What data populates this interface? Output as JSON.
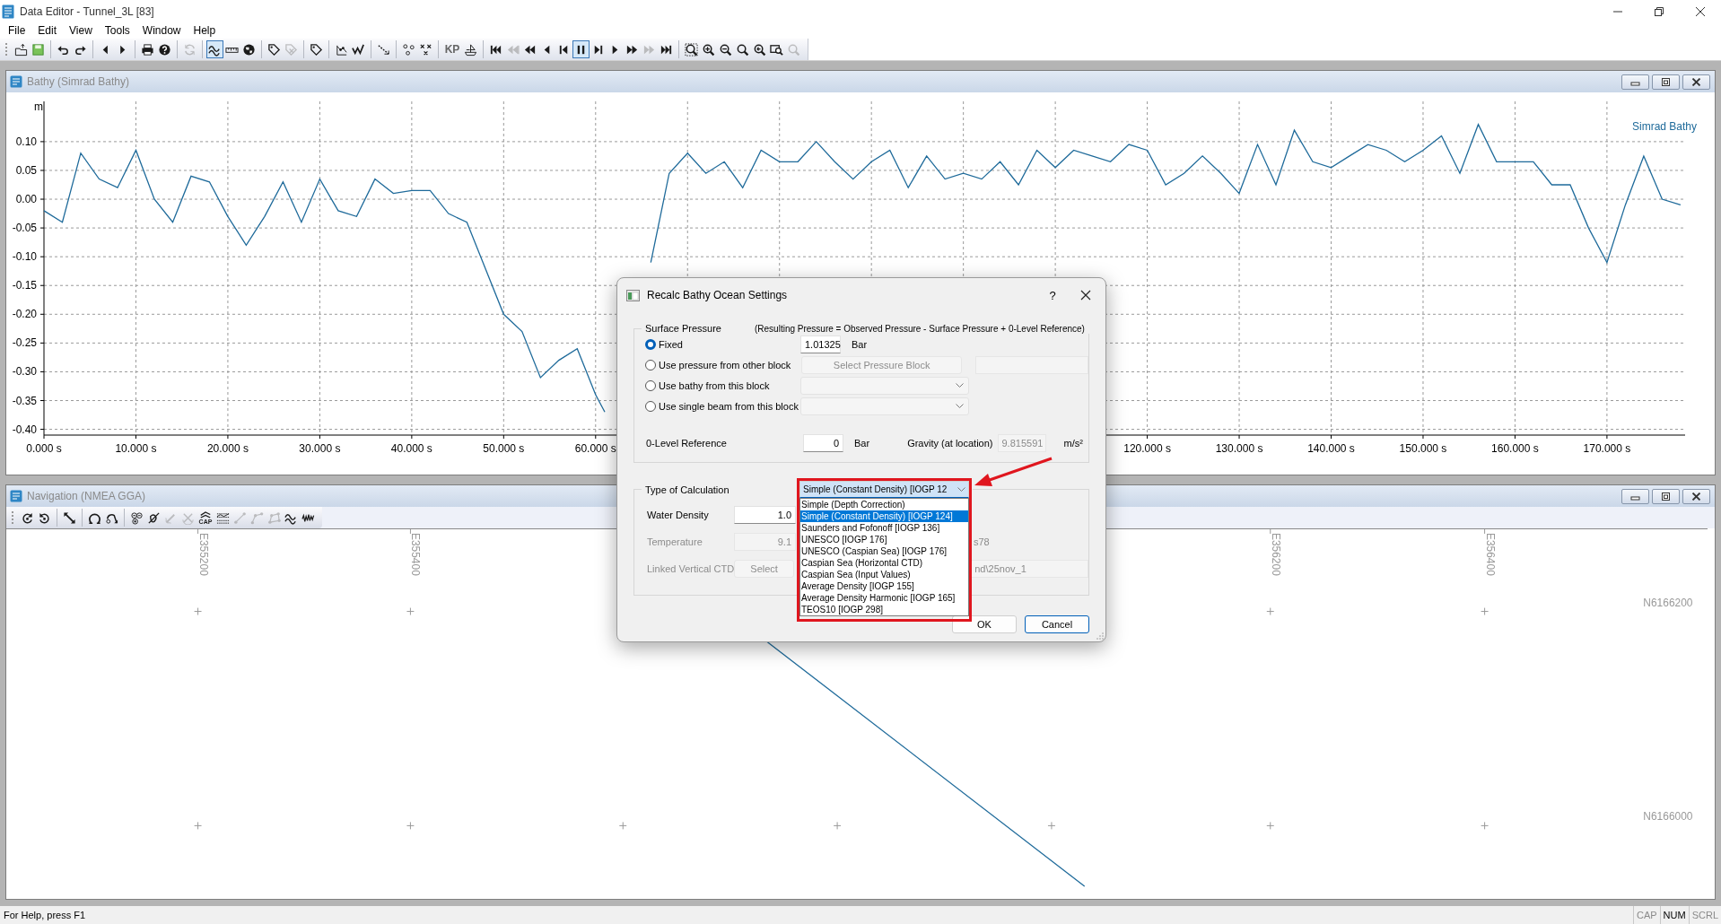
{
  "window": {
    "title": "Data Editor - Tunnel_3L [83]"
  },
  "menu": [
    "File",
    "Edit",
    "View",
    "Tools",
    "Window",
    "Help"
  ],
  "toolbar": [
    [
      {
        "kind": "folder",
        "selected": false,
        "disabled": false
      },
      {
        "kind": "floppy",
        "selected": false,
        "disabled": false
      }
    ],
    [
      {
        "kind": "undo",
        "selected": false,
        "disabled": false
      },
      {
        "kind": "redo",
        "selected": false,
        "disabled": false
      }
    ],
    [
      {
        "kind": "tri-left",
        "selected": false,
        "disabled": false
      },
      {
        "kind": "tri-right",
        "selected": false,
        "disabled": false
      }
    ],
    [
      {
        "kind": "printer",
        "selected": false,
        "disabled": false
      },
      {
        "kind": "help",
        "selected": false,
        "disabled": false
      }
    ],
    [
      {
        "kind": "refresh",
        "selected": false,
        "disabled": true
      }
    ],
    [
      {
        "kind": "wave",
        "selected": true,
        "disabled": false
      },
      {
        "kind": "ruler",
        "selected": false,
        "disabled": false
      },
      {
        "kind": "globe",
        "selected": false,
        "disabled": false
      }
    ],
    [
      {
        "kind": "tag",
        "selected": false,
        "disabled": false
      },
      {
        "kind": "tag-x",
        "selected": false,
        "disabled": true
      }
    ],
    [
      {
        "kind": "tag",
        "selected": false,
        "disabled": false
      }
    ],
    [
      {
        "kind": "graph",
        "selected": false,
        "disabled": false
      },
      {
        "kind": "zigzag",
        "selected": false,
        "disabled": false
      }
    ],
    [
      {
        "kind": "diagonal",
        "selected": false,
        "disabled": false
      }
    ],
    [
      {
        "kind": "dots",
        "selected": false,
        "disabled": false
      },
      {
        "kind": "dots-x",
        "selected": false,
        "disabled": false
      }
    ],
    [
      {
        "kind": "text",
        "label": "KP",
        "selected": false,
        "disabled": false
      },
      {
        "kind": "boat",
        "selected": false,
        "disabled": false
      }
    ],
    [
      {
        "kind": "first",
        "selected": false,
        "disabled": false
      },
      {
        "kind": "fastback",
        "selected": false,
        "disabled": true
      },
      {
        "kind": "rewind",
        "selected": false,
        "disabled": false
      },
      {
        "kind": "back",
        "selected": false,
        "disabled": false
      },
      {
        "kind": "prev",
        "selected": false,
        "disabled": false
      },
      {
        "kind": "pause",
        "selected": true,
        "disabled": false
      },
      {
        "kind": "next",
        "selected": false,
        "disabled": false
      },
      {
        "kind": "play",
        "selected": false,
        "disabled": false
      },
      {
        "kind": "fastfwd",
        "selected": false,
        "disabled": false
      },
      {
        "kind": "fastfwd",
        "selected": false,
        "disabled": true
      },
      {
        "kind": "last",
        "selected": false,
        "disabled": false
      }
    ],
    [
      {
        "kind": "zoom-box",
        "selected": false,
        "disabled": false
      },
      {
        "kind": "zoom-in",
        "selected": false,
        "disabled": false
      },
      {
        "kind": "zoom-out",
        "selected": false,
        "disabled": false
      },
      {
        "kind": "zoom",
        "selected": false,
        "disabled": false
      },
      {
        "kind": "zoom-back",
        "selected": false,
        "disabled": false
      },
      {
        "kind": "zoom-window",
        "selected": false,
        "disabled": false
      },
      {
        "kind": "zoom",
        "selected": false,
        "disabled": true
      }
    ]
  ],
  "bathy_window": {
    "title": "Bathy (Simrad Bathy)",
    "chart_data": {
      "type": "line",
      "ylabel": "m",
      "grid": true,
      "x": [
        0,
        2,
        4,
        6,
        8,
        10,
        12,
        14,
        16,
        18,
        20,
        22,
        24,
        26,
        28,
        30,
        32,
        34,
        36,
        38,
        40,
        42,
        44,
        46,
        48,
        50,
        52,
        54,
        56,
        58,
        60,
        61,
        63,
        66,
        68,
        70,
        72,
        74,
        76,
        78,
        80,
        82,
        84,
        86,
        88,
        90,
        92,
        94,
        96,
        98,
        100,
        102,
        104,
        106,
        108,
        110,
        112,
        114,
        116,
        118,
        120,
        122,
        124,
        126,
        128,
        130,
        132,
        134,
        136,
        138,
        140,
        142,
        144,
        146,
        148,
        150,
        152,
        154,
        156,
        158,
        160,
        162,
        164,
        166,
        168,
        170,
        172,
        174,
        176,
        178
      ],
      "series": [
        {
          "name": "Simrad Bathy",
          "color": "#1e6a9a",
          "values": [
            -0.02,
            -0.04,
            0.08,
            0.035,
            0.02,
            0.085,
            0,
            -0.04,
            0.04,
            0.03,
            -0.03,
            -0.08,
            -0.03,
            0.03,
            -0.04,
            0.035,
            -0.02,
            -0.03,
            0.035,
            0.01,
            0.015,
            0.015,
            -0.025,
            -0.04,
            -0.12,
            -0.2,
            -0.23,
            -0.31,
            -0.28,
            -0.26,
            -0.34,
            -0.37,
            null,
            -0.11,
            0.045,
            0.08,
            0.045,
            0.065,
            0.02,
            0.085,
            0.065,
            0.065,
            0.1,
            0.065,
            0.035,
            0.065,
            0.085,
            0.02,
            0.075,
            0.035,
            0.045,
            0.035,
            0.065,
            0.025,
            0.085,
            0.055,
            0.085,
            0.075,
            0.065,
            0.095,
            0.085,
            0.025,
            0.045,
            0.075,
            0.045,
            0.01,
            0.095,
            0.025,
            0.12,
            0.065,
            0.055,
            0.075,
            0.095,
            0.085,
            0.065,
            0.085,
            0.11,
            0.045,
            0.13,
            0.065,
            0.065,
            0.065,
            0.025,
            0.025,
            -0.05,
            -0.11,
            -0.01,
            0.075,
            0,
            -0.01
          ]
        }
      ],
      "xlim": [
        0,
        178.5
      ],
      "ylim": [
        -0.41,
        0.17
      ],
      "xticks": [
        {
          "value": 0,
          "label": "0.000 s"
        },
        {
          "value": 10,
          "label": "10.000 s"
        },
        {
          "value": 20,
          "label": "20.000 s"
        },
        {
          "value": 30,
          "label": "30.000 s"
        },
        {
          "value": 40,
          "label": "40.000 s"
        },
        {
          "value": 50,
          "label": "50.000 s"
        },
        {
          "value": 60,
          "label": "60.000 s"
        },
        {
          "value": 120,
          "label": "120.000 s"
        },
        {
          "value": 130,
          "label": "130.000 s"
        },
        {
          "value": 140,
          "label": "140.000 s"
        },
        {
          "value": 150,
          "label": "150.000 s"
        },
        {
          "value": 160,
          "label": "160.000 s"
        },
        {
          "value": 170,
          "label": "170.000 s"
        }
      ],
      "yticks": [
        {
          "value": 0.1,
          "label": "0.10"
        },
        {
          "value": 0.05,
          "label": "0.05"
        },
        {
          "value": 0,
          "label": "0.00"
        },
        {
          "value": -0.05,
          "label": "-0.05"
        },
        {
          "value": -0.1,
          "label": "-0.10"
        },
        {
          "value": -0.15,
          "label": "-0.15"
        },
        {
          "value": -0.2,
          "label": "-0.20"
        },
        {
          "value": -0.25,
          "label": "-0.25"
        },
        {
          "value": -0.3,
          "label": "-0.30"
        },
        {
          "value": -0.35,
          "label": "-0.35"
        },
        {
          "value": -0.4,
          "label": "-0.40"
        }
      ]
    }
  },
  "navigation_window": {
    "title": "Navigation (NMEA GGA)",
    "toolbar": [
      [
        {
          "kind": "rotate-cw",
          "disabled": false
        },
        {
          "kind": "rotate-ccw",
          "disabled": false
        }
      ],
      [
        {
          "kind": "diag-arrow",
          "disabled": false
        }
      ],
      [
        {
          "kind": "loop",
          "disabled": false
        },
        {
          "kind": "route",
          "disabled": false
        }
      ],
      [
        {
          "kind": "circles",
          "disabled": false
        },
        {
          "kind": "pen-cross",
          "disabled": false
        },
        {
          "kind": "sonar",
          "disabled": true
        },
        {
          "kind": "sonar-x",
          "disabled": true
        },
        {
          "kind": "cap",
          "label": "CAP",
          "disabled": false
        },
        {
          "kind": "hatch",
          "disabled": false
        },
        {
          "kind": "segment",
          "disabled": true
        },
        {
          "kind": "polyline",
          "disabled": true
        },
        {
          "kind": "polygon",
          "disabled": true
        },
        {
          "kind": "wave",
          "disabled": false
        },
        {
          "kind": "wave2",
          "disabled": false
        }
      ]
    ],
    "map": {
      "eastings": [
        "E355200",
        "E355400",
        "E356200",
        "E356400"
      ],
      "northings": [
        "N6166200",
        "N6166000"
      ]
    }
  },
  "dialog": {
    "title": "Recalc Bathy Ocean Settings",
    "help": "?",
    "surface_pressure": {
      "label": "Surface Pressure",
      "note": "(Resulting Pressure = Observed Pressure - Surface Pressure + 0-Level Reference)",
      "options": [
        {
          "label": "Fixed",
          "selected": true
        },
        {
          "label": "Use pressure from other block",
          "selected": false
        },
        {
          "label": "Use bathy from this block",
          "selected": false
        },
        {
          "label": "Use single beam from this block",
          "selected": false
        }
      ],
      "fixed": {
        "value": "1.01325",
        "unit": "Bar"
      },
      "pressure_block_button": {
        "label": "Select Pressure Block",
        "disabled": true
      },
      "zero_level": {
        "label": "0-Level Reference",
        "value": "0",
        "unit": "Bar"
      },
      "gravity": {
        "label": "Gravity (at location)",
        "value": "9.815591",
        "unit": "m/s²"
      }
    },
    "calculation": {
      "label": "Type of Calculation",
      "value": "Simple (Constant Density) [IOGP 12",
      "expanded": true,
      "options": [
        {
          "label": "Simple (Depth Correction)",
          "selected": false
        },
        {
          "label": "Simple (Constant Density) [IOGP 124]",
          "selected": true
        },
        {
          "label": "Saunders and Fofonoff [IOGP 136]",
          "selected": false
        },
        {
          "label": "UNESCO [IOGP 176]",
          "selected": false
        },
        {
          "label": "UNESCO (Caspian Sea) [IOGP 176]",
          "selected": false
        },
        {
          "label": "Caspian Sea (Horizontal CTD)",
          "selected": false
        },
        {
          "label": "Caspian Sea (Input Values)",
          "selected": false
        },
        {
          "label": "Average Density [IOGP 155]",
          "selected": false
        },
        {
          "label": "Average Density Harmonic [IOGP 165]",
          "selected": false
        },
        {
          "label": "TEOS10 [IOGP 298]",
          "selected": false
        }
      ],
      "highlight": {
        "color": "#e0161e"
      },
      "pointer_arrow": {
        "color": "#e0161e"
      }
    },
    "water_density": {
      "label": "Water Density",
      "value": "1.0",
      "disabled": false
    },
    "temperature": {
      "label": "Temperature",
      "value": "9.1",
      "tail": "s78",
      "disabled": true
    },
    "linked_ctd": {
      "label": "Linked Vertical CTD",
      "button": "Select",
      "path": "nd\\25nov_1",
      "disabled": true
    },
    "buttons": [
      {
        "label": "OK",
        "default": false
      },
      {
        "label": "Cancel",
        "default": true
      }
    ]
  },
  "status_bar": {
    "text": "For Help, press F1",
    "indicators": [
      {
        "label": "CAP",
        "on": false
      },
      {
        "label": "NUM",
        "on": true
      },
      {
        "label": "SCRL",
        "on": false
      }
    ]
  }
}
